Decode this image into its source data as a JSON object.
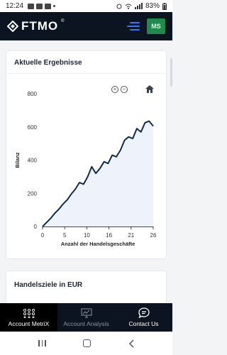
{
  "status_bar": {
    "time": "12:24",
    "battery": "83%"
  },
  "header": {
    "brand": "FTMO",
    "brand_mark": "®",
    "avatar_initials": "MS"
  },
  "results_card": {
    "title": "Aktuelle Ergebnisse"
  },
  "goals_card": {
    "title": "Handelsziele in EUR"
  },
  "chart_data": {
    "type": "area",
    "ylabel": "Bilanz",
    "xlabel": "Anzahl der Handelsgeschäfte",
    "x_ticks": [
      "0",
      "5",
      "10",
      "16",
      "21",
      "26"
    ],
    "y_ticks": [
      "0",
      "200",
      "400",
      "600",
      "800"
    ],
    "xlim": [
      0,
      26
    ],
    "ylim": [
      0,
      800
    ],
    "x": [
      0,
      1,
      2,
      3,
      4,
      5,
      6,
      7,
      8,
      9,
      10,
      11,
      12,
      13,
      14,
      15,
      16,
      17,
      18,
      19,
      20,
      21,
      22,
      23,
      24,
      25,
      26
    ],
    "y": [
      0,
      25,
      50,
      80,
      105,
      135,
      160,
      195,
      225,
      265,
      255,
      300,
      360,
      320,
      350,
      390,
      380,
      430,
      420,
      460,
      520,
      540,
      530,
      590,
      570,
      625,
      635,
      605
    ],
    "line_color": "#142a4a",
    "fill_color": "#eef3fb",
    "grid": false
  },
  "bottom_nav": {
    "items": [
      {
        "label": "Account MetriX",
        "icon": "dots-grid-icon",
        "active": true
      },
      {
        "label": "Account Analysis",
        "icon": "chart-monitor-icon",
        "active": false
      },
      {
        "label": "Contact Us",
        "icon": "chat-bubble-icon",
        "active": false
      }
    ]
  },
  "colors": {
    "header_bg": "#0d1421",
    "accent_blue": "#2f7bf5",
    "avatar_green": "#1f8a4c"
  }
}
